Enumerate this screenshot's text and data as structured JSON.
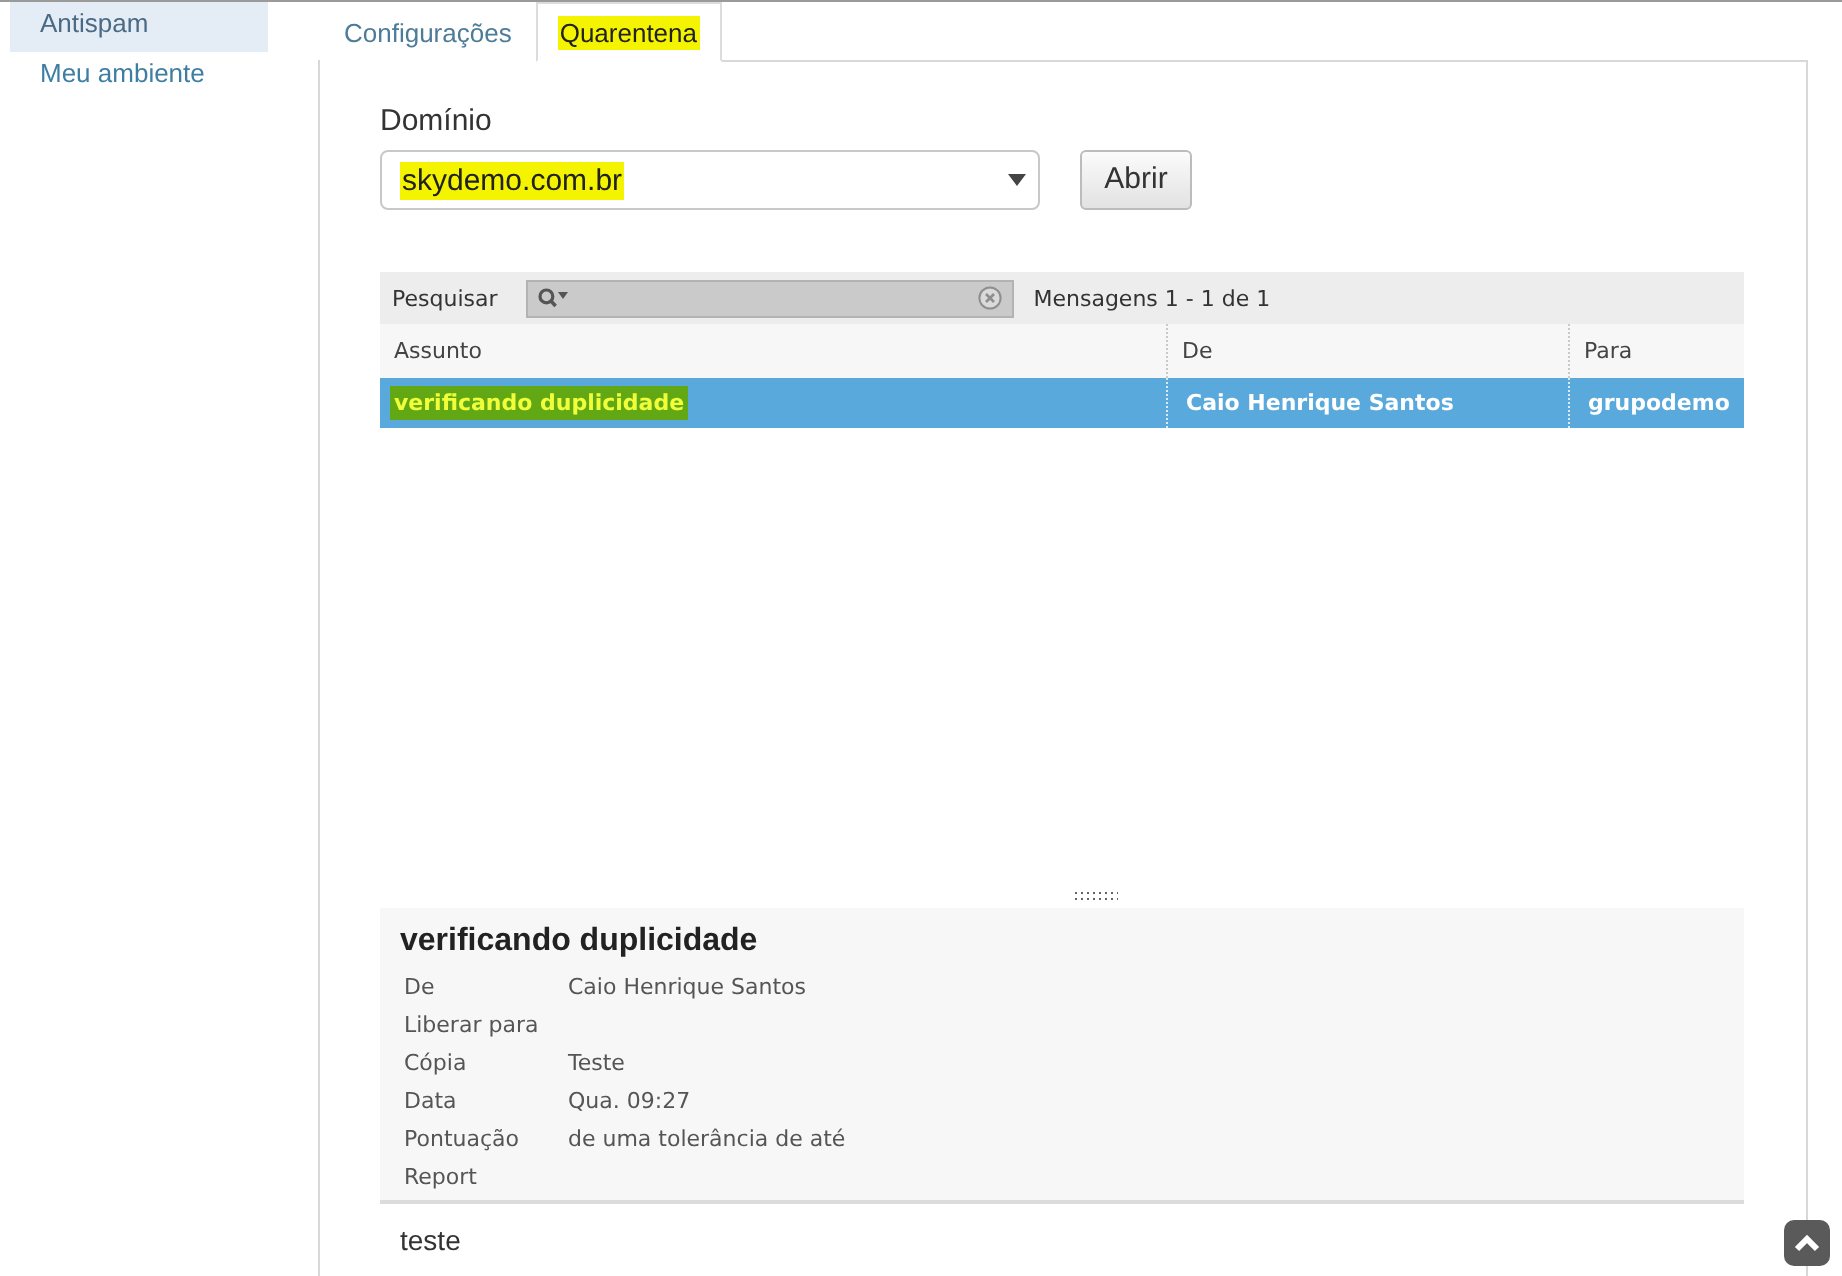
{
  "sidebar": {
    "items": [
      {
        "label": "Antispam",
        "selected": true
      },
      {
        "label": "Meu ambiente",
        "selected": false
      }
    ]
  },
  "tabs": [
    {
      "label": "Configurações",
      "selected": false,
      "highlighted": false
    },
    {
      "label": "Quarentena",
      "selected": true,
      "highlighted": true
    }
  ],
  "domain": {
    "label": "Domínio",
    "value": "skydemo.com.br",
    "highlighted": true
  },
  "open_button": {
    "label": "Abrir"
  },
  "message_grid": {
    "search_label": "Pesquisar",
    "count": "Mensagens 1 - 1 de 1",
    "columns": [
      "Assunto",
      "De",
      "Para"
    ],
    "rows": [
      {
        "selected": true,
        "cells": [
          {
            "text": "verificando duplicidade",
            "highlighted": true
          },
          {
            "text": "Caio Henrique Santos",
            "highlighted": false
          },
          {
            "text": "grupodemo",
            "highlighted": false
          }
        ]
      }
    ]
  },
  "preview": {
    "title": "verificando duplicidade",
    "fields": [
      {
        "label": "De",
        "value": "Caio Henrique Santos"
      },
      {
        "label": "Liberar para"
      },
      {
        "label": "Cópia",
        "value": "Teste"
      },
      {
        "label": "Data",
        "value": "Qua. 09:27"
      },
      {
        "label": "Pontuação",
        "value": "de uma tolerância de até"
      },
      {
        "label": "Report"
      }
    ],
    "body": "teste"
  }
}
